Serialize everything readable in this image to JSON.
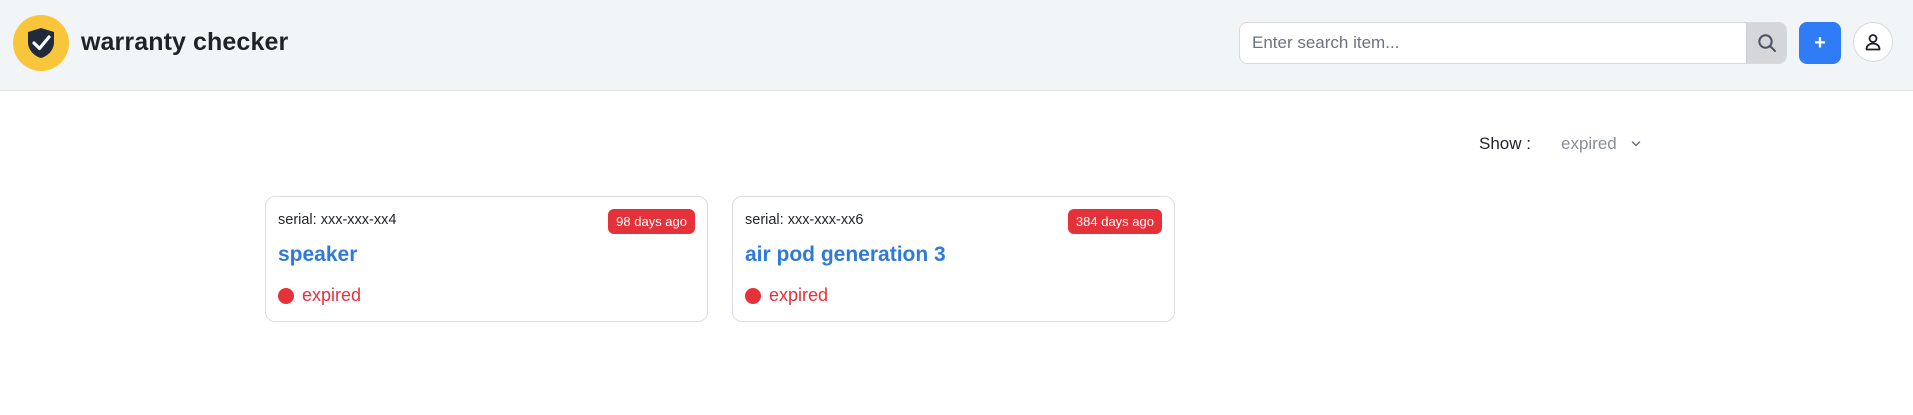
{
  "app": {
    "title": "warranty checker",
    "logo_icon": "shield-check-icon",
    "brand_color": "#f8c53b"
  },
  "search": {
    "placeholder": "Enter search item...",
    "value": "",
    "icon": "search-icon"
  },
  "actions": {
    "add_label": "+",
    "add_color": "#2f7cf6",
    "profile_icon": "user-icon"
  },
  "filter": {
    "label": "Show :",
    "selected": "expired",
    "icon": "chevron-down-icon"
  },
  "items": [
    {
      "serial": "serial: xxx-xxx-xx4",
      "age": "98 days ago",
      "name": "speaker",
      "status": "expired"
    },
    {
      "serial": "serial: xxx-xxx-xx6",
      "age": "384 days ago",
      "name": "air pod generation 3",
      "status": "expired"
    }
  ],
  "colors": {
    "expired": "#e5323a",
    "link": "#2f7ad8"
  }
}
